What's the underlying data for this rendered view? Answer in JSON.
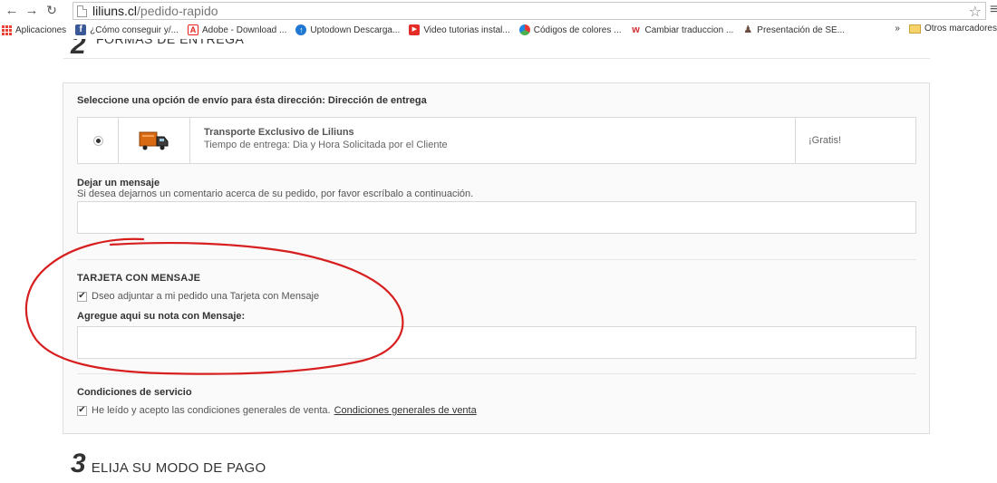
{
  "browser": {
    "url_host": "liliuns.cl",
    "url_path": "/pedido-rapido",
    "bookmarks": [
      {
        "label": "Aplicaciones",
        "icon": "apps-grid-icon",
        "color": "#e94235"
      },
      {
        "label": "¿Cómo conseguir y/...",
        "icon": "facebook-icon",
        "color": "#3b5998"
      },
      {
        "label": "Adobe - Download ...",
        "icon": "adobe-icon",
        "color": "#e8231e"
      },
      {
        "label": "Uptodown Descarga...",
        "icon": "uptodown-icon",
        "color": "#1f78d1"
      },
      {
        "label": "Video tutorias instal...",
        "icon": "youtube-icon",
        "color": "#e52d27"
      },
      {
        "label": "Códigos de colores ...",
        "icon": "color-wheel-icon",
        "color": "#4caf50"
      },
      {
        "label": "Cambiar traduccion ...",
        "icon": "w-icon",
        "color": "#d32f2f"
      },
      {
        "label": "Presentación de SE...",
        "icon": "figure-icon",
        "color": "#6d4c41"
      }
    ],
    "bookmarks_more": "»",
    "other_bookmarks": "Otros marcadores"
  },
  "step2": {
    "number": "2",
    "title": "FORMAS DE ENTREGA"
  },
  "shipping": {
    "heading": "Seleccione una opción de envío para ésta dirección: Dirección de entrega",
    "option": {
      "selected": true,
      "name": "Transporte Exclusivo de Liliuns",
      "time": "Tiempo de entrega: Dia y Hora Solicitada por el Cliente",
      "price": "¡Gratis!"
    }
  },
  "message": {
    "heading": "Dejar un mensaje",
    "hint": "Si desea dejarnos un comentario acerca de su pedido, por favor escríbalo a continuación.",
    "value": ""
  },
  "card": {
    "heading": "TARJETA CON MENSAJE",
    "checkbox_label": "Dseo adjuntar a mi pedido una Tarjeta con Mensaje",
    "checked": true,
    "note_label": "Agregue aqui su nota con Mensaje:",
    "note_value": ""
  },
  "conditions": {
    "heading": "Condiciones de servicio",
    "checkbox_label": "He leído y acepto las condiciones generales de venta.",
    "link_label": "Condiciones generales de venta",
    "checked": true
  },
  "step3": {
    "number": "3",
    "title": "ELIJA SU MODO DE PAGO"
  },
  "annotation_color": "#d81f1f"
}
